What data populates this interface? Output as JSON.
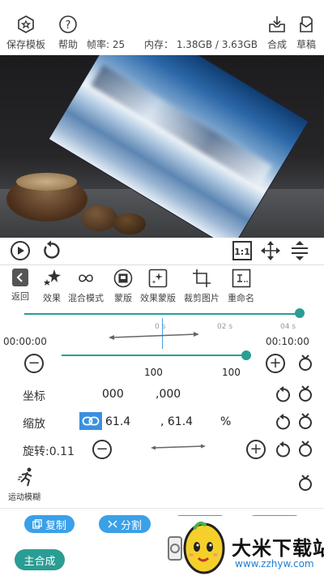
{
  "topbar": {
    "save_template": "保存模板",
    "help": "帮助",
    "frame_rate": "帧率: 25",
    "memory": "内存： 1.38GB / 3.63GB",
    "compose": "合成",
    "draft": "草稿"
  },
  "fx_toolbar": {
    "items": [
      {
        "label": "返回",
        "icon": "back-icon"
      },
      {
        "label": "效果",
        "icon": "stars-icon"
      },
      {
        "label": "混合模式",
        "icon": "blend-icon"
      },
      {
        "label": "蒙版",
        "icon": "mask-icon"
      },
      {
        "label": "效果蒙版",
        "icon": "effect-mask-icon"
      },
      {
        "label": "裁剪图片",
        "icon": "crop-icon"
      },
      {
        "label": "重命名",
        "icon": "rename-icon"
      }
    ]
  },
  "timeline": {
    "start_time": "00:00:00",
    "end_time": "00:10:00",
    "ticks": [
      "0 s",
      "02 s",
      "04 s"
    ],
    "position_fraction": 1.0
  },
  "props": {
    "scale_slider": {
      "left_value": "100",
      "right_value": "100",
      "fraction": 1.0
    },
    "position": {
      "label": "坐标",
      "x": "000",
      "y": ",000"
    },
    "scale": {
      "label": "缩放",
      "x": "61.4",
      "y": ", 61.4",
      "unit": "%"
    },
    "rotate": {
      "label": "旋转:0.11"
    },
    "motion_blur": {
      "label": "运动模糊"
    }
  },
  "bottom": {
    "copy": "复制",
    "split": "分割",
    "main_compose": "主合成"
  },
  "watermark": {
    "title": "大米下载站",
    "url": "www.zzhyw.com"
  },
  "colors": {
    "accent": "#2a9d94",
    "pill": "#3aa0e8"
  }
}
